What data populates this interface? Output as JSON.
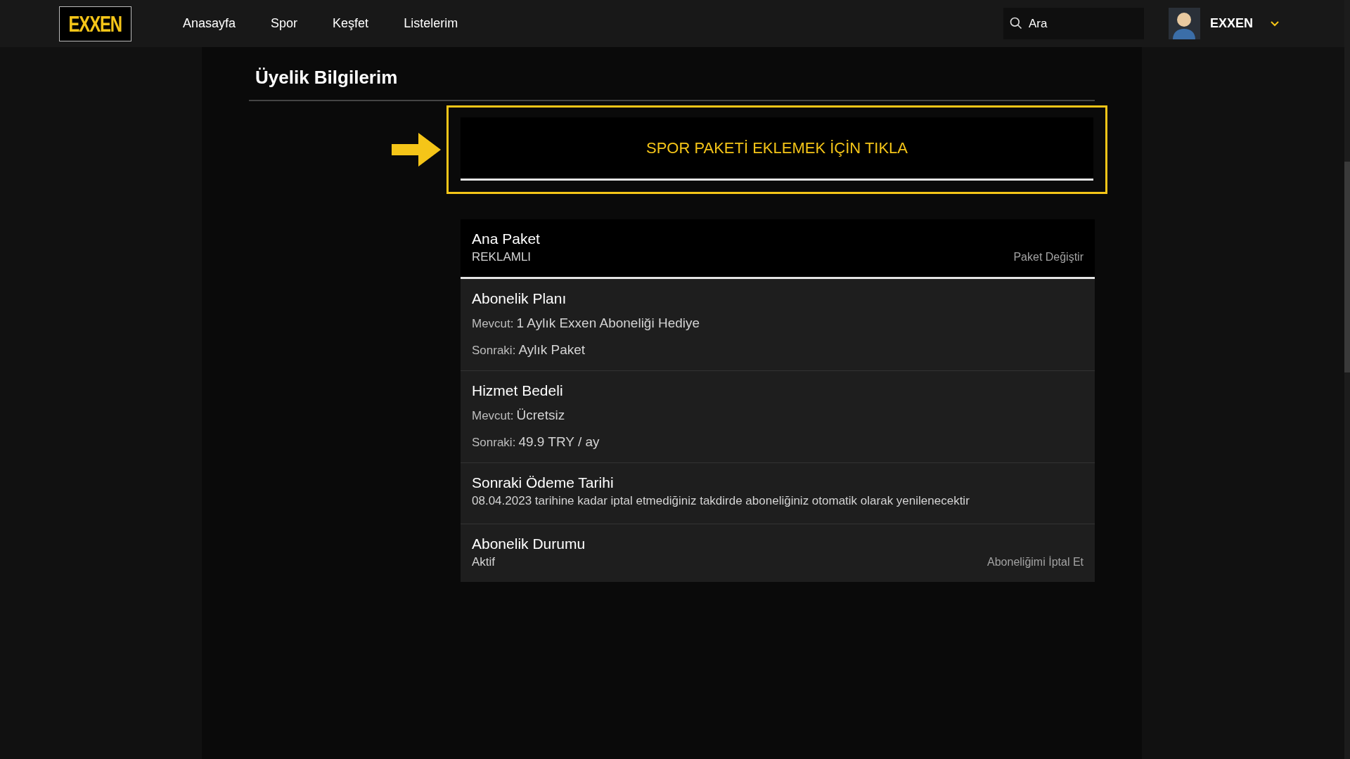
{
  "header": {
    "logo": "EXXEN",
    "nav": [
      {
        "label": "Anasayfa"
      },
      {
        "label": "Spor"
      },
      {
        "label": "Keşfet"
      },
      {
        "label": "Listelerim"
      }
    ],
    "search": {
      "placeholder": "Ara"
    },
    "user": {
      "name": "EXXEN"
    }
  },
  "page": {
    "title": "Üyelik Bilgilerim",
    "banner": "SPOR PAKETİ EKLEMEK İÇİN TIKLA",
    "rows": [
      {
        "kind": "package",
        "title": "Ana Paket",
        "subtitle": "REKLAMLI",
        "action": "Paket Değiştir"
      },
      {
        "kind": "detail",
        "title": "Abonelik Planı",
        "lines": [
          {
            "label": "Mevcut:",
            "value": "1 Aylık Exxen Aboneliği Hediye"
          },
          {
            "label": "Sonraki:",
            "value": "Aylık Paket"
          }
        ]
      },
      {
        "kind": "detail",
        "title": "Hizmet Bedeli",
        "lines": [
          {
            "label": "Mevcut:",
            "value": "Ücretsiz"
          },
          {
            "label": "Sonraki:",
            "value": "49.9 TRY / ay"
          }
        ]
      },
      {
        "kind": "note",
        "title": "Sonraki Ödeme Tarihi",
        "subtitle": "08.04.2023 tarihine kadar iptal etmediğiniz takdirde aboneliğiniz otomatik olarak yenilenecektir"
      },
      {
        "kind": "status",
        "title": "Abonelik Durumu",
        "subtitle": "Aktif",
        "action": "Aboneliğimi İptal Et"
      }
    ]
  }
}
